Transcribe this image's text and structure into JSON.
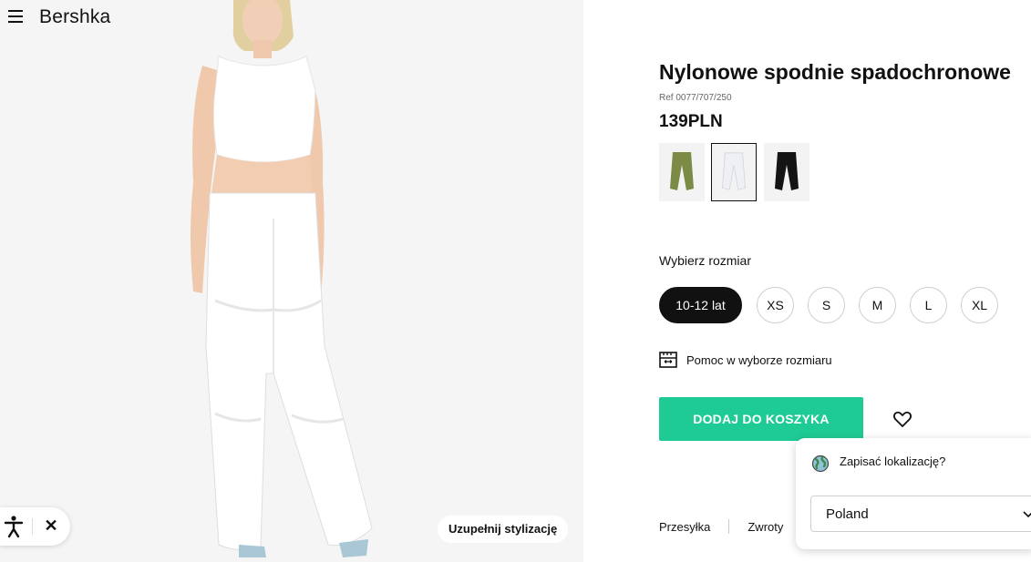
{
  "header": {
    "brand": "Bershka"
  },
  "product": {
    "title": "Nylonowe spodnie spadochronowe",
    "ref": "Ref 0077/707/250",
    "price": "139PLN",
    "colors": [
      {
        "name": "khaki",
        "hex": "#7b8a45",
        "selected": false
      },
      {
        "name": "white",
        "hex": "#eef0f5",
        "selected": true
      },
      {
        "name": "black",
        "hex": "#141414",
        "selected": false
      }
    ]
  },
  "sizes": {
    "label": "Wybierz rozmiar",
    "options": [
      "10-12 lat",
      "XS",
      "S",
      "M",
      "L",
      "XL"
    ],
    "selected": "10-12 lat",
    "help": "Pomoc w wyborze rozmiaru"
  },
  "actions": {
    "add_to_cart": "DODAJ DO KOSZYKA",
    "complete_look": "Uzupełnij stylizację"
  },
  "links": [
    "Przesyłka",
    "Zwroty"
  ],
  "location_popup": {
    "question": "Zapisać lokalizację?",
    "country": "Poland"
  },
  "accessibility": {
    "close": "✕"
  },
  "colors": {
    "accent": "#1fcb94",
    "text": "#111111"
  }
}
